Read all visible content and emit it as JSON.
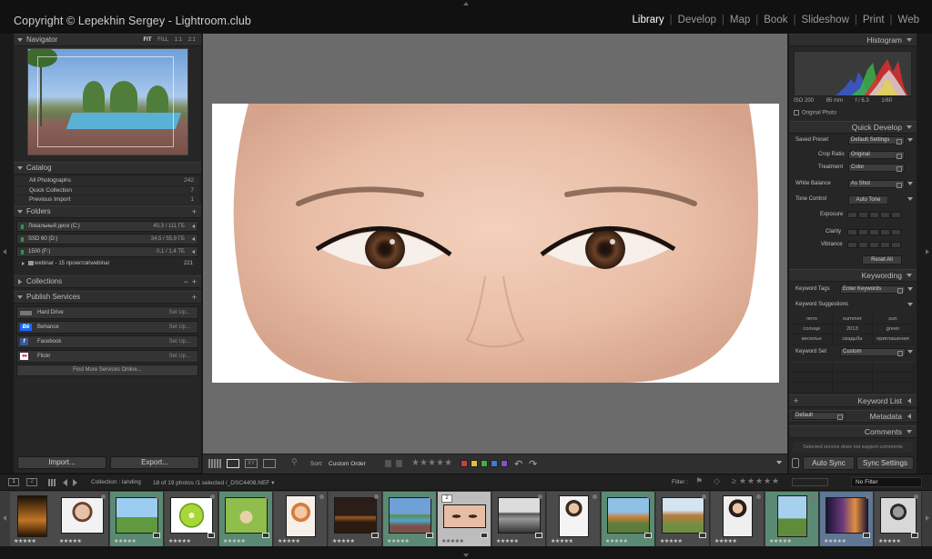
{
  "app": {
    "copyright": "Copyright © Lepekhin Sergey - Lightroom.club",
    "modules": [
      "Library",
      "Develop",
      "Map",
      "Book",
      "Slideshow",
      "Print",
      "Web"
    ],
    "active_module": "Library"
  },
  "left": {
    "navigator": {
      "title": "Navigator",
      "options": [
        "FIT",
        "FILL",
        "1:1",
        "2:1"
      ],
      "active_option": "FIT"
    },
    "catalog": {
      "title": "Catalog",
      "items": [
        {
          "label": "All Photographs",
          "count": "242"
        },
        {
          "label": "Quick Collection",
          "count": "7"
        },
        {
          "label": "Previous Import",
          "count": "1"
        }
      ]
    },
    "folders": {
      "title": "Folders",
      "volumes": [
        {
          "label": "Локальный диск (C:)",
          "usage": "40,3 / 111 ГБ"
        },
        {
          "label": "SSD 60 (D:)",
          "usage": "34,5 / 55,9 ГБ"
        },
        {
          "label": "1500 (F:)",
          "usage": "0,1 / 1,4 ТБ"
        }
      ],
      "subfolder": {
        "label": "webinar - 15 проектов\\webinar",
        "count": "221"
      }
    },
    "collections": {
      "title": "Collections"
    },
    "publish": {
      "title": "Publish Services",
      "services": [
        {
          "label": "Hard Drive",
          "action": "Set Up...",
          "icon": "hard-drive-icon",
          "color": "#777777",
          "glyph": ""
        },
        {
          "label": "Behance",
          "action": "Set Up...",
          "icon": "behance-icon",
          "color": "#1769ff",
          "glyph": "Bē"
        },
        {
          "label": "Facebook",
          "action": "Set Up...",
          "icon": "facebook-icon",
          "color": "#3b5998",
          "glyph": "f"
        },
        {
          "label": "Flickr",
          "action": "Set Up...",
          "icon": "flickr-icon",
          "color": "#ffffff",
          "glyph": "●●"
        }
      ],
      "find_more": "Find More Services Online..."
    },
    "import_label": "Import...",
    "export_label": "Export..."
  },
  "toolbar": {
    "sort_label": "Sort:",
    "sort_value": "Custom Order",
    "color_labels": [
      "#d23b3b",
      "#d9c03a",
      "#4aa84a",
      "#3c7cd6",
      "#8a4ec9"
    ]
  },
  "right": {
    "histogram": {
      "title": "Histogram",
      "iso": "ISO 200",
      "focal": "85 mm",
      "aperture": "f / 6.3",
      "shutter": "1/60",
      "original_photo": "Original Photo"
    },
    "quick_develop": {
      "title": "Quick Develop",
      "saved_preset_label": "Saved Preset",
      "saved_preset_value": "Default Settings",
      "crop_ratio_label": "Crop Ratio",
      "crop_ratio_value": "Original",
      "treatment_label": "Treatment",
      "treatment_value": "Color",
      "white_balance_label": "White Balance",
      "white_balance_value": "As Shot",
      "tone_control_label": "Tone Control",
      "auto_tone": "Auto Tone",
      "exposure_label": "Exposure",
      "clarity_label": "Clarity",
      "vibrance_label": "Vibrance",
      "reset_all": "Reset All"
    },
    "keywording": {
      "title": "Keywording",
      "tags_label": "Keyword Tags",
      "tags_value": "Enter Keywords",
      "suggestions_title": "Keyword Suggestions",
      "suggestions": [
        [
          "лето",
          "summer",
          "sun"
        ],
        [
          "солнце",
          "2013",
          "green"
        ],
        [
          "веселье",
          "свадьба",
          "приглашения"
        ]
      ],
      "set_label": "Keyword Set",
      "set_value": "Custom"
    },
    "keyword_list": {
      "title": "Keyword List"
    },
    "metadata": {
      "title": "Metadata",
      "preset": "Default"
    },
    "comments": {
      "title": "Comments",
      "note": "Selected service does not support comments"
    },
    "auto_sync": "Auto Sync",
    "sync_settings": "Sync Settings"
  },
  "filmstrip": {
    "views": [
      "1",
      "2"
    ],
    "source": "Collection : landing",
    "count": "18 of 19 photos /1 selected /_DSC4408.NEF ▾",
    "filter_label": "Filter :",
    "filter_value": "No Filter",
    "selected_index": "2"
  }
}
